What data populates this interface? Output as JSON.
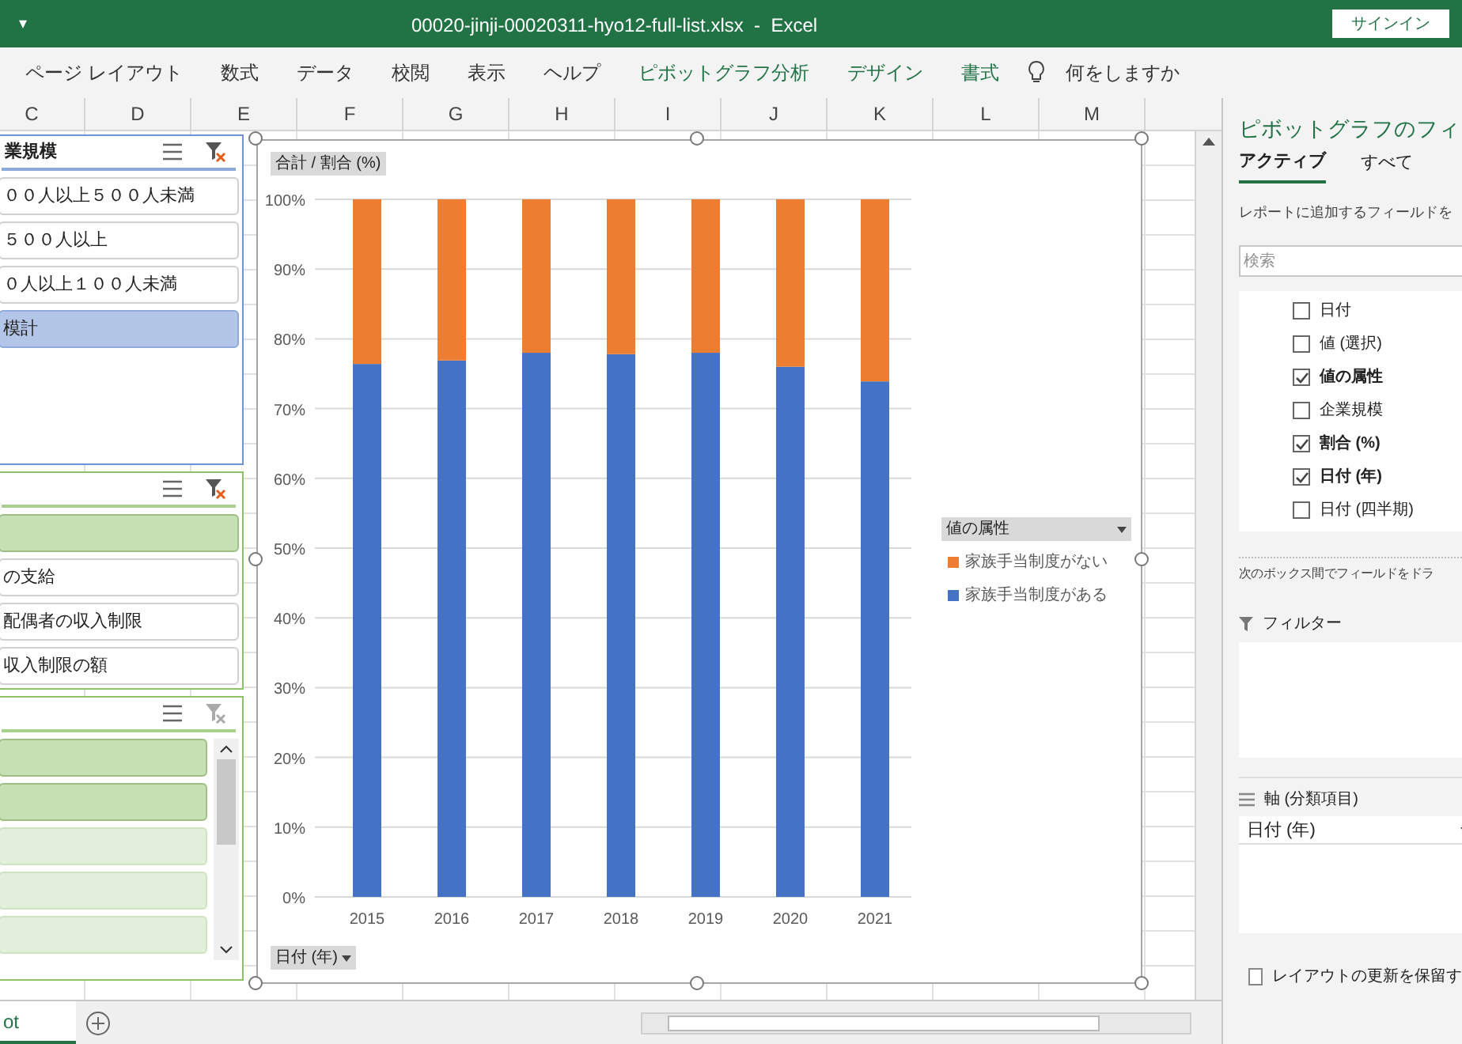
{
  "window": {
    "title": "00020-jinji-00020311-hyo12-full-list.xlsx  -  Excel",
    "quick_access": "▾",
    "signin": "サインイン"
  },
  "ribbon": {
    "tabs": [
      {
        "label": "ページ レイアウト",
        "kind": "normal"
      },
      {
        "label": "数式",
        "kind": "normal"
      },
      {
        "label": "データ",
        "kind": "normal"
      },
      {
        "label": "校閲",
        "kind": "normal"
      },
      {
        "label": "表示",
        "kind": "normal"
      },
      {
        "label": "ヘルプ",
        "kind": "normal"
      },
      {
        "label": "ピボットグラフ分析",
        "kind": "context"
      },
      {
        "label": "デザイン",
        "kind": "context"
      },
      {
        "label": "書式",
        "kind": "context"
      }
    ],
    "tell_me": "何をしますか"
  },
  "columns": [
    "C",
    "D",
    "E",
    "F",
    "G",
    "H",
    "I",
    "J",
    "K",
    "L",
    "M"
  ],
  "slicers": [
    {
      "kind": "blue",
      "title": "業規模",
      "items": [
        {
          "label": "００人以上５００人未満",
          "selected": false
        },
        {
          "label": "５００人以上",
          "selected": false
        },
        {
          "label": "０人以上１００人未満",
          "selected": false
        },
        {
          "label": "模計",
          "selected": true
        }
      ]
    },
    {
      "kind": "green",
      "items": [
        {
          "selected": true
        },
        {
          "label": "の支給",
          "selected": false
        },
        {
          "label": "配偶者の収入制限",
          "selected": false
        },
        {
          "label": "収入制限の額",
          "selected": false
        }
      ]
    },
    {
      "kind": "green-scroll",
      "items": [
        {
          "selected": true
        },
        {
          "selected": true
        },
        {
          "selected": false
        },
        {
          "selected": false
        },
        {
          "selected": false
        }
      ]
    }
  ],
  "chart": {
    "value_button": "合計 / 割合 (%)",
    "axis_button": "日付 (年)",
    "legend_button": "値の属性",
    "chart_data": {
      "type": "bar",
      "stacked": true,
      "grid": true,
      "categories": [
        "2015",
        "2016",
        "2017",
        "2018",
        "2019",
        "2020",
        "2021"
      ],
      "ylim": [
        0,
        100
      ],
      "yticks": [
        {
          "value": 0,
          "label": "0%"
        },
        {
          "value": 10,
          "label": "10%"
        },
        {
          "value": 20,
          "label": "20%"
        },
        {
          "value": 30,
          "label": "30%"
        },
        {
          "value": 40,
          "label": "40%"
        },
        {
          "value": 50,
          "label": "50%"
        },
        {
          "value": 60,
          "label": "60%"
        },
        {
          "value": 70,
          "label": "70%"
        },
        {
          "value": 80,
          "label": "80%"
        },
        {
          "value": 90,
          "label": "90%"
        },
        {
          "value": 100,
          "label": "100%"
        }
      ],
      "series": [
        {
          "name": "家族手当制度がある",
          "color": "#4472c4",
          "values": [
            76.4,
            76.9,
            78.0,
            77.8,
            78.0,
            76.0,
            73.9
          ]
        },
        {
          "name": "家族手当制度がない",
          "color": "#ed7d31",
          "values": [
            23.6,
            23.1,
            22.0,
            22.2,
            22.0,
            24.0,
            26.1
          ]
        }
      ]
    }
  },
  "sheet_tabs": [
    {
      "label": "ot",
      "selected": true
    }
  ],
  "field_pane": {
    "title": "ピボットグラフのフィ",
    "tabs": [
      {
        "label": "アクティブ",
        "selected": true
      },
      {
        "label": "すべて",
        "selected": false
      }
    ],
    "hint": "レポートに追加するフィールドを",
    "search": {
      "placeholder": "検索"
    },
    "fields": [
      {
        "label": "日付",
        "checked": false
      },
      {
        "label": "値 (選択)",
        "checked": false
      },
      {
        "label": "値の属性",
        "checked": true
      },
      {
        "label": "企業規模",
        "checked": false
      },
      {
        "label": "割合 (%)",
        "checked": true
      },
      {
        "label": "日付 (年)",
        "checked": true
      },
      {
        "label": "日付 (四半期)",
        "checked": false
      }
    ],
    "drag_hint": "次のボックス間でフィールドをドラ",
    "filter_area": "フィルター",
    "axis_area": "軸 (分類項目)",
    "axis_items": [
      "日付 (年)"
    ],
    "defer": {
      "label": "レイアウトの更新を保留す",
      "checked": false
    }
  }
}
